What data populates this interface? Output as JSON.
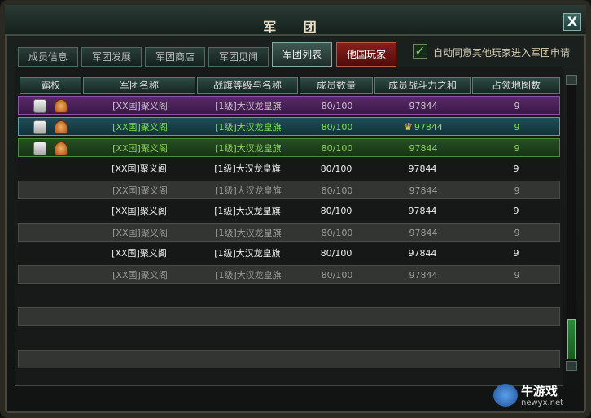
{
  "window": {
    "title": "军 团",
    "close_label": "X"
  },
  "tabs": [
    {
      "label": "成员信息"
    },
    {
      "label": "军团发展"
    },
    {
      "label": "军团商店"
    },
    {
      "label": "军团见闻"
    },
    {
      "label": "军团列表"
    },
    {
      "label": "他国玩家"
    }
  ],
  "auto_accept": {
    "label": "自动同意其他玩家进入军团申请",
    "checked": true
  },
  "columns": [
    "霸权",
    "军团名称",
    "战旗等级与名称",
    "成员数量",
    "成员战斗力之和",
    "占领地图数"
  ],
  "rows": [
    {
      "name": "[XX国]聚义阁",
      "flag": "[1级]大汉龙皇旗",
      "members": "80/100",
      "power": "97844",
      "maps": "9"
    },
    {
      "name": "[XX国]聚义阁",
      "flag": "[1级]大汉龙皇旗",
      "members": "80/100",
      "power": "97844",
      "maps": "9"
    },
    {
      "name": "[XX国]聚义阁",
      "flag": "[1级]大汉龙皇旗",
      "members": "80/100",
      "power": "97844",
      "maps": "9"
    },
    {
      "name": "[XX国]聚义阁",
      "flag": "[1级]大汉龙皇旗",
      "members": "80/100",
      "power": "97844",
      "maps": "9"
    },
    {
      "name": "[XX国]聚义阁",
      "flag": "[1级]大汉龙皇旗",
      "members": "80/100",
      "power": "97844",
      "maps": "9"
    },
    {
      "name": "[XX国]聚义阁",
      "flag": "[1级]大汉龙皇旗",
      "members": "80/100",
      "power": "97844",
      "maps": "9"
    },
    {
      "name": "[XX国]聚义阁",
      "flag": "[1级]大汉龙皇旗",
      "members": "80/100",
      "power": "97844",
      "maps": "9"
    },
    {
      "name": "[XX国]聚义阁",
      "flag": "[1级]大汉龙皇旗",
      "members": "80/100",
      "power": "97844",
      "maps": "9"
    },
    {
      "name": "[XX国]聚义阁",
      "flag": "[1级]大汉龙皇旗",
      "members": "80/100",
      "power": "97844",
      "maps": "9"
    }
  ],
  "watermark": {
    "title": "牛游戏",
    "url": "newyx.net"
  }
}
